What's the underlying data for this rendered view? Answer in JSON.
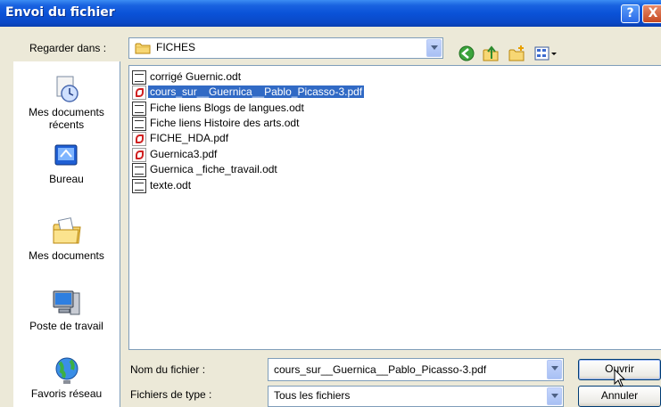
{
  "dialog": {
    "title": "Envoi du fichier",
    "help_glyph": "?",
    "close_glyph": "X"
  },
  "lookin": {
    "label": "Regarder dans :",
    "folder": "FICHES",
    "folder_icon": "folder-icon"
  },
  "toolbar": {
    "icons": [
      "back-icon",
      "up-folder-icon",
      "new-folder-icon",
      "view-menu-icon"
    ]
  },
  "places": [
    {
      "label": "Mes documents récents",
      "icon": "recent-documents-icon"
    },
    {
      "label": "Bureau",
      "icon": "desktop-icon"
    },
    {
      "label": "Mes documents",
      "icon": "my-documents-icon"
    },
    {
      "label": "Poste de travail",
      "icon": "my-computer-icon"
    },
    {
      "label": "Favoris réseau",
      "icon": "network-places-icon"
    }
  ],
  "files": [
    {
      "name": "corrigé Guernic.odt",
      "type": "odt",
      "selected": false
    },
    {
      "name": "cours_sur__Guernica__Pablo_Picasso-3.pdf",
      "type": "pdf",
      "selected": true
    },
    {
      "name": "Fiche liens Blogs de langues.odt",
      "type": "odt",
      "selected": false
    },
    {
      "name": "Fiche liens Histoire des arts.odt",
      "type": "odt",
      "selected": false
    },
    {
      "name": "FICHE_HDA.pdf",
      "type": "pdf",
      "selected": false
    },
    {
      "name": "Guernica3.pdf",
      "type": "pdf",
      "selected": false
    },
    {
      "name": "Guernica _fiche_travail.odt",
      "type": "odt",
      "selected": false
    },
    {
      "name": "texte.odt",
      "type": "odt",
      "selected": false
    }
  ],
  "filename": {
    "label": "Nom du fichier :",
    "value": "cours_sur__Guernica__Pablo_Picasso-3.pdf"
  },
  "filetype": {
    "label": "Fichiers de type :",
    "value": "Tous les fichiers"
  },
  "buttons": {
    "open": "Ouvrir",
    "cancel": "Annuler"
  },
  "colors": {
    "titlebar": "#0a52d8",
    "selection": "#316ac5",
    "dialog_bg": "#ece9d8"
  }
}
